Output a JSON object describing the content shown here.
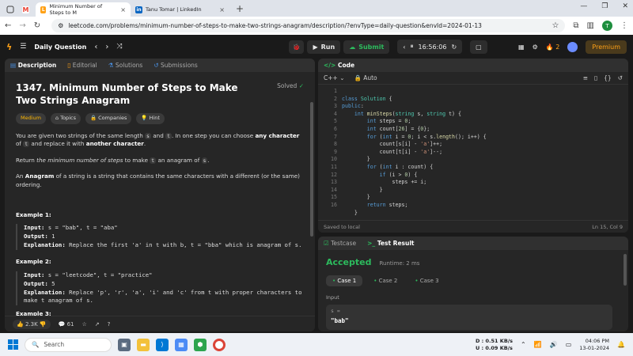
{
  "browser": {
    "tabs": [
      {
        "title": "Minimum Number of Steps to M",
        "favicon": "leetcode"
      },
      {
        "title": "Tanu Tomar | LinkedIn",
        "favicon": "linkedin"
      }
    ],
    "url": "leetcode.com/problems/minimum-number-of-steps-to-make-two-strings-anagram/description/?envType=daily-question&envId=2024-01-13",
    "profile_initial": "T"
  },
  "topbar": {
    "daily_label": "Daily Question",
    "run_label": "Run",
    "submit_label": "Submit",
    "timer": "16:56:06",
    "streak": "2",
    "premium_label": "Premium"
  },
  "left_tabs": [
    "Description",
    "Editorial",
    "Solutions",
    "Submissions"
  ],
  "problem": {
    "title": "1347. Minimum Number of Steps to Make Two Strings Anagram",
    "status": "Solved",
    "difficulty": "Medium",
    "tags": [
      "Topics",
      "Companies",
      "Hint"
    ],
    "p1_a": "You are given two strings of the same length ",
    "p1_s": "s",
    "p1_and": " and ",
    "p1_t": "t",
    "p1_b": ". In one step you can choose ",
    "p1_bold1": "any character",
    "p1_c": " of ",
    "p1_t2": "t",
    "p1_d": " and replace it with ",
    "p1_bold2": "another character",
    "p1_e": ".",
    "p2_a": "Return ",
    "p2_i": "the minimum number of steps",
    "p2_b": " to make ",
    "p2_t": "t",
    "p2_c": " an anagram of ",
    "p2_s": "s",
    "p2_d": ".",
    "p3_bold": "Anagram",
    "p3_rest": " of a string is a string that contains the same characters with a different (or the same) ordering.",
    "p3_pre": "An ",
    "examples": [
      {
        "title": "Example 1:",
        "input": "s = \"bab\", t = \"aba\"",
        "output": "1",
        "explanation": "Replace the first 'a' in t with b, t = \"bba\" which is anagram of s."
      },
      {
        "title": "Example 2:",
        "input": "s = \"leetcode\", t = \"practice\"",
        "output": "5",
        "explanation": "Replace 'p', 'r', 'a', 'i' and 'c' from t with proper characters to make t anagram of s."
      }
    ],
    "example3_title": "Example 3:",
    "label_input": "Input:",
    "label_output": "Output:",
    "label_explanation": "Explanation:",
    "likes": "2.3K",
    "comments": "61"
  },
  "editor": {
    "title": "Code",
    "language": "C++",
    "mode": "Auto",
    "saved": "Saved to local",
    "cursor": "Ln 15, Col 9"
  },
  "result": {
    "tabs": [
      "Testcase",
      "Test Result"
    ],
    "status": "Accepted",
    "runtime": "Runtime: 2 ms",
    "cases": [
      "Case 1",
      "Case 2",
      "Case 3"
    ],
    "input_label": "Input",
    "var_name": "s =",
    "var_value": "\"bab\""
  },
  "taskbar": {
    "search": "Search",
    "net_down": "D : 0.51 KB/s",
    "net_up": "U : 0.09 KB/s",
    "time": "04:06 PM",
    "date": "13-01-2024"
  },
  "colors": {
    "accepted": "#2cbb5d",
    "submit": "#2cbb5d",
    "medium": "#ffb800",
    "premium": "#ffa116"
  }
}
